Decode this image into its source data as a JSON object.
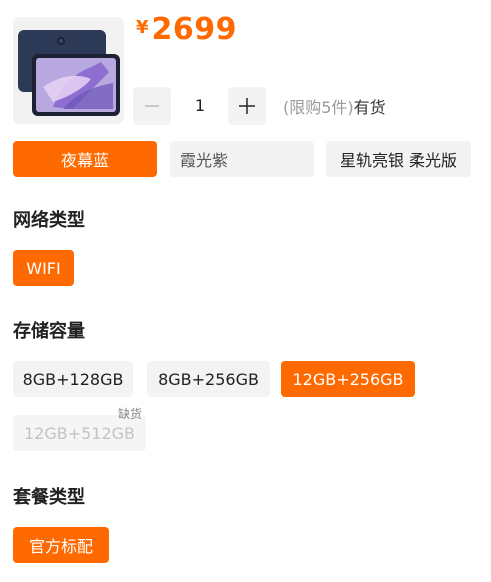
{
  "product": {
    "currency_symbol": "¥",
    "price": "2699",
    "quantity": "1",
    "limit_text": "(限购5件)",
    "stock_text": "有货"
  },
  "colors": {
    "items": [
      {
        "label": "夜幕蓝",
        "state": "selected"
      },
      {
        "label": "霞光紫",
        "state": "normal"
      },
      {
        "label": "星轨亮银 柔光版",
        "state": "normal"
      }
    ]
  },
  "network": {
    "title": "网络类型",
    "items": [
      {
        "label": "WIFI",
        "state": "selected"
      }
    ]
  },
  "storage": {
    "title": "存储容量",
    "items": [
      {
        "label": "8GB+128GB",
        "state": "normal"
      },
      {
        "label": "8GB+256GB",
        "state": "normal"
      },
      {
        "label": "12GB+256GB",
        "state": "selected"
      },
      {
        "label": "12GB+512GB",
        "state": "disabled",
        "badge": "缺货"
      }
    ]
  },
  "package": {
    "title": "套餐类型",
    "items": [
      {
        "label": "官方标配",
        "state": "selected"
      }
    ]
  },
  "theme": {
    "accent": "#ff6a00",
    "chip_bg": "#f3f3f3",
    "disabled_text": "#c4c4c4"
  }
}
